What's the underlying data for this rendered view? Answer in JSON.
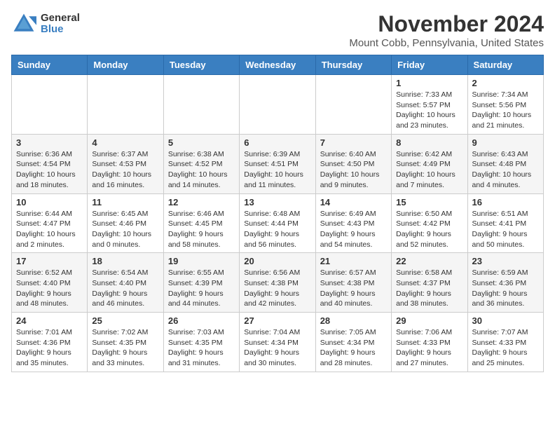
{
  "logo": {
    "general": "General",
    "blue": "Blue"
  },
  "header": {
    "month": "November 2024",
    "location": "Mount Cobb, Pennsylvania, United States"
  },
  "weekdays": [
    "Sunday",
    "Monday",
    "Tuesday",
    "Wednesday",
    "Thursday",
    "Friday",
    "Saturday"
  ],
  "weeks": [
    [
      {
        "day": "",
        "info": ""
      },
      {
        "day": "",
        "info": ""
      },
      {
        "day": "",
        "info": ""
      },
      {
        "day": "",
        "info": ""
      },
      {
        "day": "",
        "info": ""
      },
      {
        "day": "1",
        "info": "Sunrise: 7:33 AM\nSunset: 5:57 PM\nDaylight: 10 hours\nand 23 minutes."
      },
      {
        "day": "2",
        "info": "Sunrise: 7:34 AM\nSunset: 5:56 PM\nDaylight: 10 hours\nand 21 minutes."
      }
    ],
    [
      {
        "day": "3",
        "info": "Sunrise: 6:36 AM\nSunset: 4:54 PM\nDaylight: 10 hours\nand 18 minutes."
      },
      {
        "day": "4",
        "info": "Sunrise: 6:37 AM\nSunset: 4:53 PM\nDaylight: 10 hours\nand 16 minutes."
      },
      {
        "day": "5",
        "info": "Sunrise: 6:38 AM\nSunset: 4:52 PM\nDaylight: 10 hours\nand 14 minutes."
      },
      {
        "day": "6",
        "info": "Sunrise: 6:39 AM\nSunset: 4:51 PM\nDaylight: 10 hours\nand 11 minutes."
      },
      {
        "day": "7",
        "info": "Sunrise: 6:40 AM\nSunset: 4:50 PM\nDaylight: 10 hours\nand 9 minutes."
      },
      {
        "day": "8",
        "info": "Sunrise: 6:42 AM\nSunset: 4:49 PM\nDaylight: 10 hours\nand 7 minutes."
      },
      {
        "day": "9",
        "info": "Sunrise: 6:43 AM\nSunset: 4:48 PM\nDaylight: 10 hours\nand 4 minutes."
      }
    ],
    [
      {
        "day": "10",
        "info": "Sunrise: 6:44 AM\nSunset: 4:47 PM\nDaylight: 10 hours\nand 2 minutes."
      },
      {
        "day": "11",
        "info": "Sunrise: 6:45 AM\nSunset: 4:46 PM\nDaylight: 10 hours\nand 0 minutes."
      },
      {
        "day": "12",
        "info": "Sunrise: 6:46 AM\nSunset: 4:45 PM\nDaylight: 9 hours\nand 58 minutes."
      },
      {
        "day": "13",
        "info": "Sunrise: 6:48 AM\nSunset: 4:44 PM\nDaylight: 9 hours\nand 56 minutes."
      },
      {
        "day": "14",
        "info": "Sunrise: 6:49 AM\nSunset: 4:43 PM\nDaylight: 9 hours\nand 54 minutes."
      },
      {
        "day": "15",
        "info": "Sunrise: 6:50 AM\nSunset: 4:42 PM\nDaylight: 9 hours\nand 52 minutes."
      },
      {
        "day": "16",
        "info": "Sunrise: 6:51 AM\nSunset: 4:41 PM\nDaylight: 9 hours\nand 50 minutes."
      }
    ],
    [
      {
        "day": "17",
        "info": "Sunrise: 6:52 AM\nSunset: 4:40 PM\nDaylight: 9 hours\nand 48 minutes."
      },
      {
        "day": "18",
        "info": "Sunrise: 6:54 AM\nSunset: 4:40 PM\nDaylight: 9 hours\nand 46 minutes."
      },
      {
        "day": "19",
        "info": "Sunrise: 6:55 AM\nSunset: 4:39 PM\nDaylight: 9 hours\nand 44 minutes."
      },
      {
        "day": "20",
        "info": "Sunrise: 6:56 AM\nSunset: 4:38 PM\nDaylight: 9 hours\nand 42 minutes."
      },
      {
        "day": "21",
        "info": "Sunrise: 6:57 AM\nSunset: 4:38 PM\nDaylight: 9 hours\nand 40 minutes."
      },
      {
        "day": "22",
        "info": "Sunrise: 6:58 AM\nSunset: 4:37 PM\nDaylight: 9 hours\nand 38 minutes."
      },
      {
        "day": "23",
        "info": "Sunrise: 6:59 AM\nSunset: 4:36 PM\nDaylight: 9 hours\nand 36 minutes."
      }
    ],
    [
      {
        "day": "24",
        "info": "Sunrise: 7:01 AM\nSunset: 4:36 PM\nDaylight: 9 hours\nand 35 minutes."
      },
      {
        "day": "25",
        "info": "Sunrise: 7:02 AM\nSunset: 4:35 PM\nDaylight: 9 hours\nand 33 minutes."
      },
      {
        "day": "26",
        "info": "Sunrise: 7:03 AM\nSunset: 4:35 PM\nDaylight: 9 hours\nand 31 minutes."
      },
      {
        "day": "27",
        "info": "Sunrise: 7:04 AM\nSunset: 4:34 PM\nDaylight: 9 hours\nand 30 minutes."
      },
      {
        "day": "28",
        "info": "Sunrise: 7:05 AM\nSunset: 4:34 PM\nDaylight: 9 hours\nand 28 minutes."
      },
      {
        "day": "29",
        "info": "Sunrise: 7:06 AM\nSunset: 4:33 PM\nDaylight: 9 hours\nand 27 minutes."
      },
      {
        "day": "30",
        "info": "Sunrise: 7:07 AM\nSunset: 4:33 PM\nDaylight: 9 hours\nand 25 minutes."
      }
    ]
  ]
}
